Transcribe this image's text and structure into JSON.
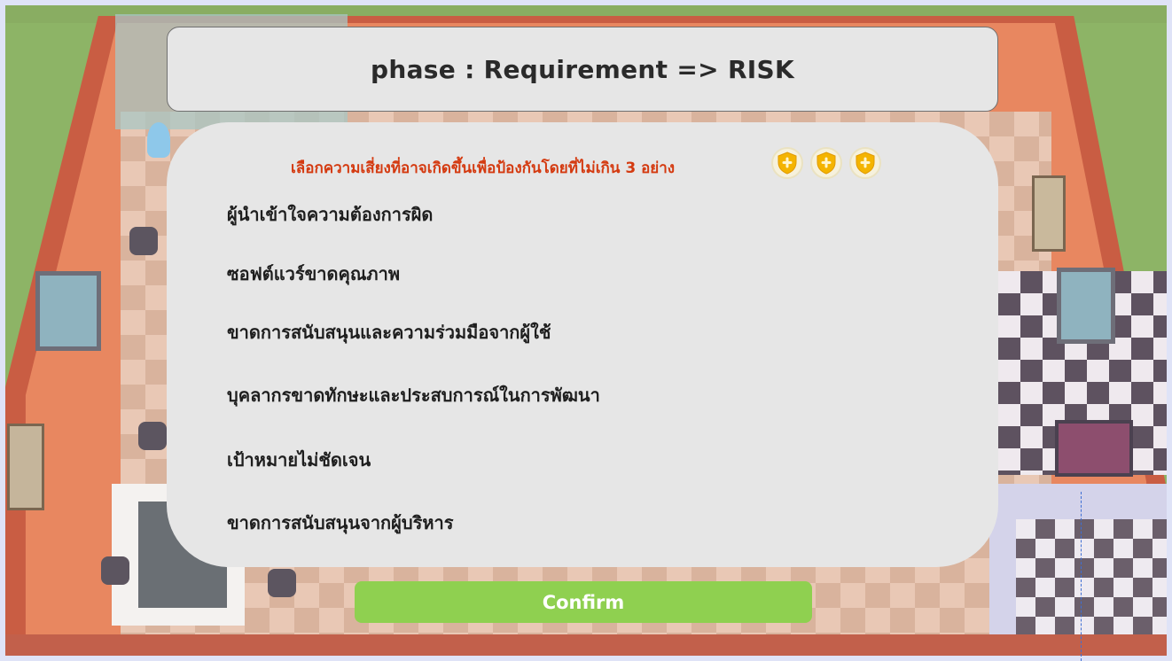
{
  "phase": {
    "title": "phase : Requirement => RISK"
  },
  "risk_panel": {
    "instruction": "เลือกความเสี่ยงที่อาจเกิดขึ้นเพื่อป้องกันโดยที่ไม่เกิน 3 อย่าง",
    "shield_icons": [
      "shield-icon",
      "shield-icon",
      "shield-icon"
    ],
    "shield_color": "#f4b400",
    "options": [
      "ผู้นำเข้าใจความต้องการผิด",
      "ซอฟต์แวร์ขาดคุณภาพ",
      "ขาดการสนับสนุนและความร่วมมือจากผู้ใช้",
      "บุคลากรขาดทักษะและประสบการณ์ในการพัฒนา",
      "เป้าหมายไม่ชัดเจน",
      "ขาดการสนับสนุนจากผู้บริหาร"
    ]
  },
  "confirm": {
    "label": "Confirm",
    "color": "#8fd050"
  },
  "colors": {
    "instruction_text": "#d43a10",
    "panel_background": "#e6e6e6"
  }
}
